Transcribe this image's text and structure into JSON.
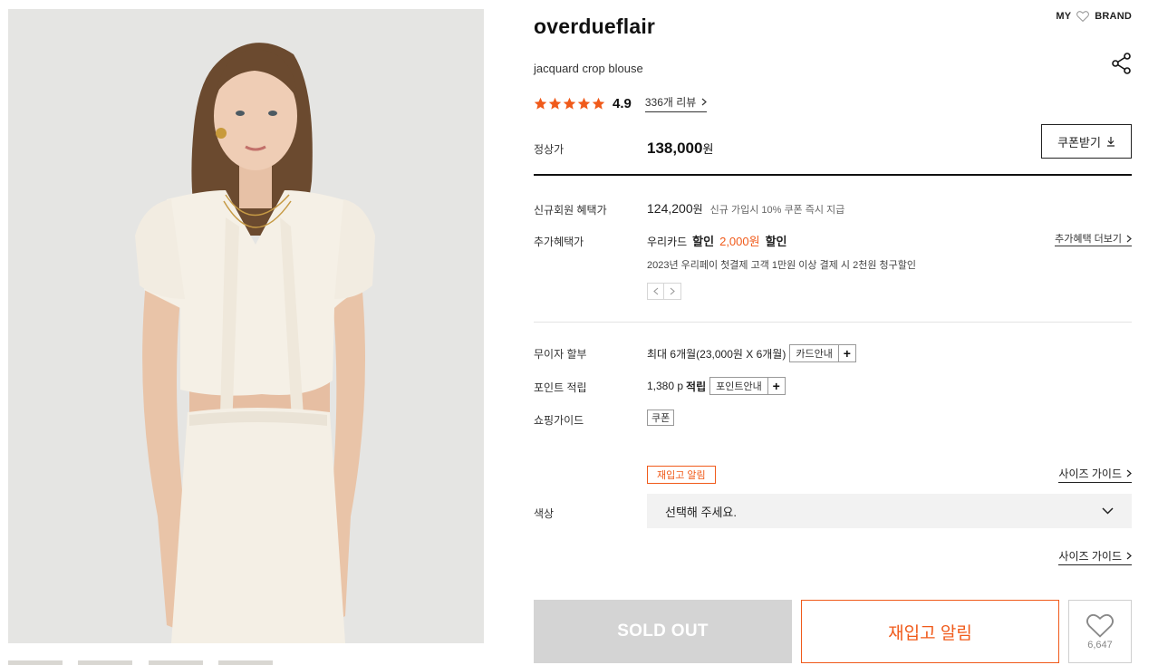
{
  "header": {
    "my_label": "MY",
    "brand_label": "BRAND"
  },
  "product": {
    "brand": "overdueflair",
    "name": "jacquard crop blouse",
    "rating": "4.9",
    "stars": 5,
    "review_link": "336개 리뷰"
  },
  "price": {
    "regular_label": "정상가",
    "regular_value": "138,000",
    "currency": "원",
    "coupon_button": "쿠폰받기",
    "member_label": "신규회원 혜택가",
    "member_value": "124,200",
    "member_note": "신규 가입시 10% 쿠폰 즉시 지급",
    "extra_label": "추가혜택가",
    "extra_card": "우리카드",
    "extra_discount_word": "할인",
    "extra_amount": "2,000원",
    "extra_discount_word2": "할인",
    "extra_more": "추가혜택 더보기",
    "extra_desc": "2023년 우리페이 첫결제 고객 1만원 이상 결제 시 2천원 청구할인"
  },
  "installment": {
    "label": "무이자 할부",
    "value": "최대 6개월(23,000원 X 6개월)",
    "button": "카드안내"
  },
  "points": {
    "label": "포인트 적립",
    "value": "1,380 p",
    "suffix": "적립",
    "button": "포인트안내"
  },
  "guide": {
    "label": "쇼핑가이드",
    "coupon": "쿠폰"
  },
  "option": {
    "restock_tag": "재입고 알림",
    "size_guide": "사이즈 가이드",
    "color_label": "색상",
    "select_placeholder": "선택해 주세요.",
    "size_guide_2": "사이즈 가이드"
  },
  "actions": {
    "soldout": "SOLD OUT",
    "restock": "재입고 알림",
    "like_count": "6,647"
  },
  "colors": {
    "accent": "#f05a1a",
    "soldout_bg": "#d4d4d4"
  },
  "icons": [
    "heart-icon",
    "share-icon",
    "star-icon",
    "chevron-right-icon",
    "download-icon",
    "chevron-down-icon",
    "plus-icon"
  ]
}
